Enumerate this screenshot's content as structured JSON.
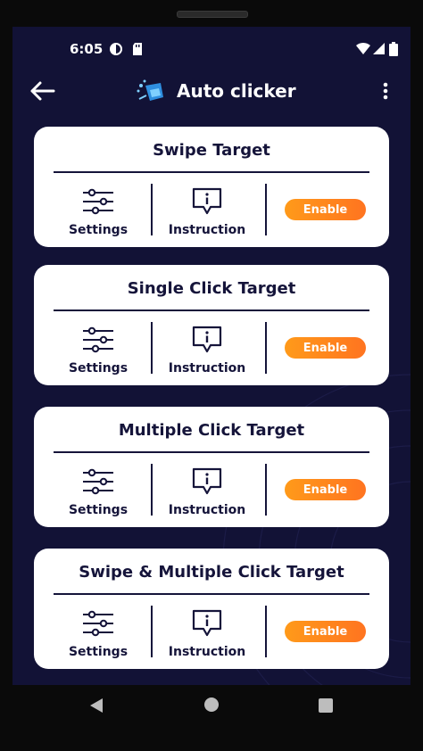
{
  "status_bar": {
    "time": "6:05"
  },
  "app_bar": {
    "title": "Auto clicker"
  },
  "cards": [
    {
      "title": "Swipe Target",
      "settings_label": "Settings",
      "instruction_label": "Instruction",
      "enable_label": "Enable"
    },
    {
      "title": "Single Click Target",
      "settings_label": "Settings",
      "instruction_label": "Instruction",
      "enable_label": "Enable"
    },
    {
      "title": "Multiple Click Target",
      "settings_label": "Settings",
      "instruction_label": "Instruction",
      "enable_label": "Enable"
    },
    {
      "title": "Swipe & Multiple Click Target",
      "settings_label": "Settings",
      "instruction_label": "Instruction",
      "enable_label": "Enable"
    }
  ],
  "colors": {
    "background": "#121236",
    "card": "#ffffff",
    "text_dark": "#15143a",
    "enable_gradient_start": "#ff9a1a",
    "enable_gradient_end": "#ff7420"
  },
  "icons": [
    "back-arrow-icon",
    "app-logo-icon",
    "more-vert-icon",
    "sliders-icon",
    "info-bubble-icon",
    "wifi-icon",
    "signal-icon",
    "battery-icon"
  ]
}
